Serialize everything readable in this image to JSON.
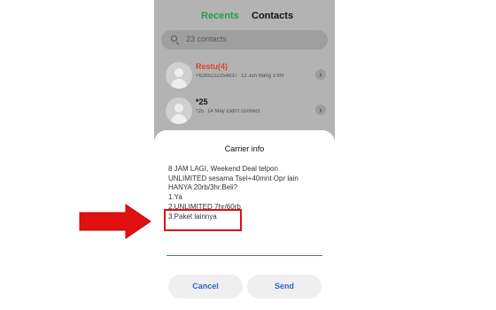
{
  "tabs": {
    "recents": "Recents",
    "contacts": "Contacts"
  },
  "search": {
    "placeholder": "23 contacts"
  },
  "contacts": [
    {
      "name": "Restu(4)",
      "number": "+6285222254837",
      "detail": "13 Jun Rang 3 tim",
      "name_color": "#d9452c"
    },
    {
      "name": "*25",
      "number": "*25",
      "detail": "14 May Didn't connect",
      "name_color": "#111111"
    }
  ],
  "dialog": {
    "title": "Carrier info",
    "message_lines": [
      "8 JAM LAGI, Weekend Deal telpon",
      "UNLIMITED sesama Tsel+40mnt Opr lain",
      "HANYA 20rb/3hr.Beli?",
      "1.Ya",
      "2.UNLIMITED 7hr/60rb",
      "3.Paket lainnya"
    ],
    "cancel_label": "Cancel",
    "send_label": "Send"
  },
  "colors": {
    "accent_green": "#1f9d55",
    "button_text_blue": "#2f66c9",
    "annotation_red": "#e01010"
  }
}
